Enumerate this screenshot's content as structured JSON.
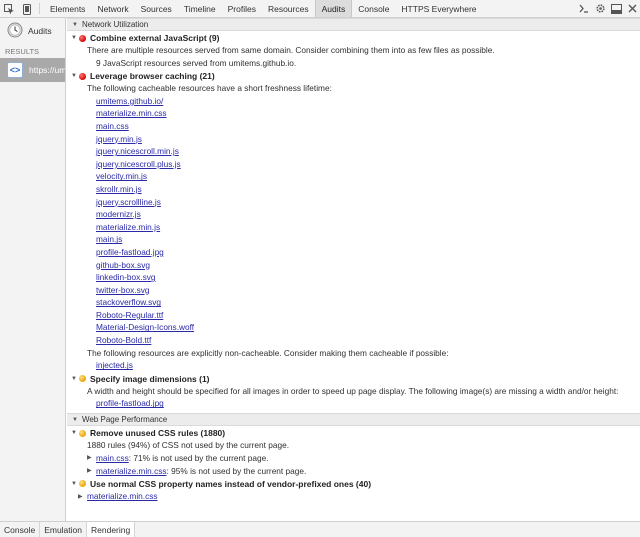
{
  "toolbar": {
    "tabs": [
      "Elements",
      "Network",
      "Sources",
      "Timeline",
      "Profiles",
      "Resources",
      "Audits",
      "Console",
      "HTTPS Everywhere"
    ],
    "active_tab": "Audits"
  },
  "sidebar": {
    "audits_label": "Audits",
    "results_label": "RESULTS",
    "result_item": "https://um"
  },
  "network": {
    "header": "Network Utilization",
    "combine": {
      "title": "Combine external JavaScript (9)",
      "desc": "There are multiple resources served from same domain. Consider combining them into as few files as possible.",
      "detail": "9 JavaScript resources served from umitems.github.io."
    },
    "caching": {
      "title": "Leverage browser caching (21)",
      "desc": "The following cacheable resources have a short freshness lifetime:",
      "files": [
        "umitems.github.io/",
        "materialize.min.css",
        "main.css",
        "jquery.min.js",
        "jquery.nicescroll.min.js",
        "jquery.nicescroll.plus.js",
        "velocity.min.js",
        "skrollr.min.js",
        "jquery.scrollline.js",
        "modernizr.js",
        "materialize.min.js",
        "main.js",
        "profile-fastload.jpg",
        "github-box.svg",
        "linkedin-box.svg",
        "twitter-box.svg",
        "stackoverflow.svg",
        "Roboto-Regular.ttf",
        "Material-Design-Icons.woff",
        "Roboto-Bold.ttf"
      ],
      "noncache_desc": "The following resources are explicitly non-cacheable. Consider making them cacheable if possible:",
      "noncache_files": [
        "injected.js"
      ]
    },
    "dimensions": {
      "title": "Specify image dimensions (1)",
      "desc": "A width and height should be specified for all images in order to speed up page display. The following image(s) are missing a width and/or height:",
      "files": [
        "profile-fastload.jpg"
      ]
    }
  },
  "performance": {
    "header": "Web Page Performance",
    "unused": {
      "title": "Remove unused CSS rules (1880)",
      "desc": "1880 rules (94%) of CSS not used by the current page.",
      "items": [
        {
          "file": "main.css",
          "text": ": 71% is not used by the current page."
        },
        {
          "file": "materialize.min.css",
          "text": ": 95% is not used by the current page."
        }
      ]
    },
    "vendor": {
      "title": "Use normal CSS property names instead of vendor-prefixed ones (40)",
      "items": [
        "materialize.min.css"
      ]
    }
  },
  "drawer": {
    "tabs": [
      "Console",
      "Emulation",
      "Rendering"
    ],
    "active_tab": "Rendering"
  }
}
